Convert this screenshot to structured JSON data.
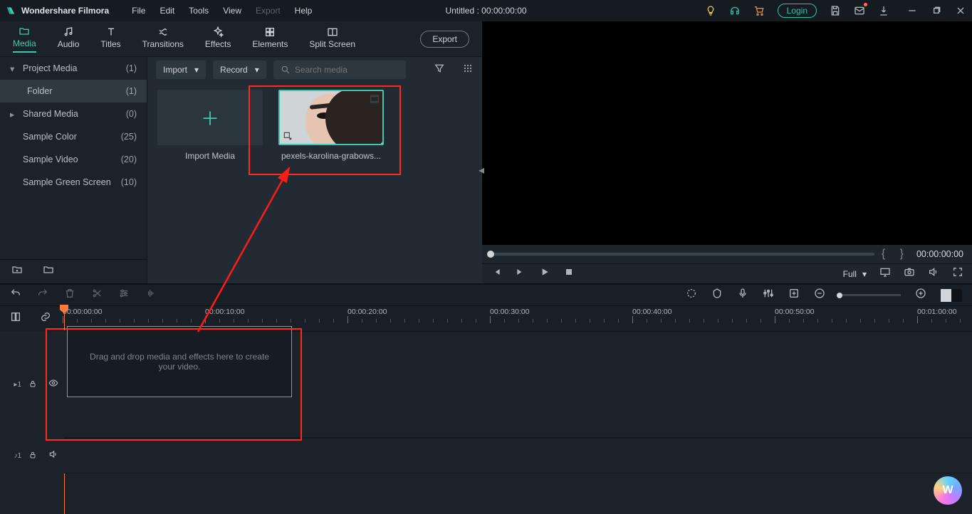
{
  "title": {
    "app": "Wondershare Filmora",
    "project": "Untitled : 00:00:00:00"
  },
  "menubar": [
    "File",
    "Edit",
    "Tools",
    "View",
    "Export",
    "Help"
  ],
  "menubar_disabled_index": 4,
  "titlebar_buttons": {
    "login": "Login"
  },
  "tabs": [
    {
      "id": "media",
      "label": "Media",
      "active": true
    },
    {
      "id": "audio",
      "label": "Audio"
    },
    {
      "id": "titles",
      "label": "Titles"
    },
    {
      "id": "transitions",
      "label": "Transitions"
    },
    {
      "id": "effects",
      "label": "Effects"
    },
    {
      "id": "elements",
      "label": "Elements"
    },
    {
      "id": "split",
      "label": "Split Screen"
    }
  ],
  "export_button": "Export",
  "sidebar": {
    "items": [
      {
        "label": "Project Media",
        "count": "(1)",
        "chev": "down"
      },
      {
        "label": "Folder",
        "count": "(1)",
        "sub": true,
        "selected": true
      },
      {
        "label": "Shared Media",
        "count": "(0)",
        "chev": "right"
      },
      {
        "label": "Sample Color",
        "count": "(25)"
      },
      {
        "label": "Sample Video",
        "count": "(20)"
      },
      {
        "label": "Sample Green Screen",
        "count": "(10)"
      }
    ]
  },
  "media_toolbar": {
    "import_label": "Import",
    "record_label": "Record",
    "search_placeholder": "Search media"
  },
  "media_grid": {
    "import_caption": "Import Media",
    "clip_caption": "pexels-karolina-grabows..."
  },
  "preview": {
    "timecode": "00:00:00:00",
    "quality": "Full"
  },
  "ruler": {
    "labels": [
      "00:00:00:00",
      "00:00:10:00",
      "00:00:20:00",
      "00:00:30:00",
      "00:00:40:00",
      "00:00:50:00",
      "00:01:00:00"
    ]
  },
  "timeline": {
    "drop_text": "Drag and drop media and effects here to create your video.",
    "video_track": "1",
    "audio_track": "1"
  }
}
